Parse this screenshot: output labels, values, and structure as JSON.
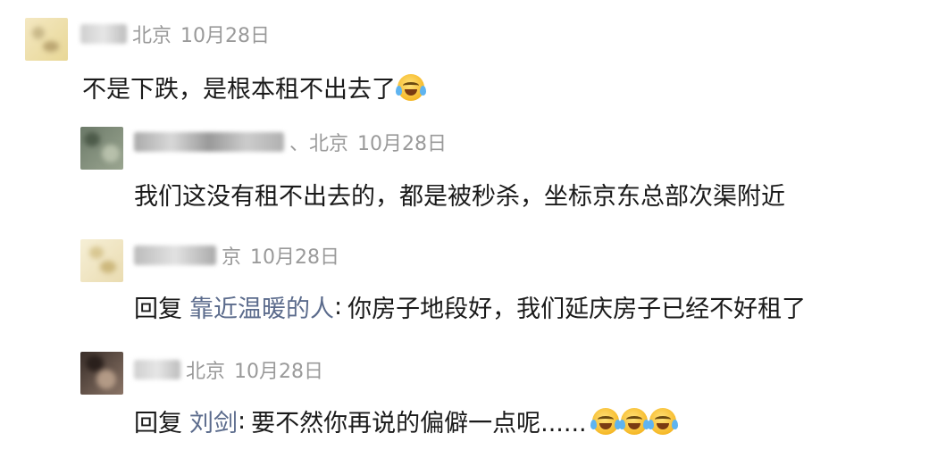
{
  "comments": [
    {
      "location": "北京",
      "date": "10月28日",
      "text": "不是下跌，是根本租不出去了"
    },
    {
      "location": "、北京",
      "date": "10月28日",
      "text": "我们这没有租不出去的，都是被秒杀，坐标京东总部次渠附近"
    },
    {
      "location": "京",
      "date": "10月28日",
      "reply_prefix": "回复",
      "reply_target": "靠近温暖的人",
      "colon": ":",
      "text": "你房子地段好，我们延庆房子已经不好租了"
    },
    {
      "location": "北京",
      "date": "10月28日",
      "reply_prefix": "回复",
      "reply_target": "刘剑",
      "colon": ":",
      "text": "要不然你再说的偏僻一点呢......"
    }
  ],
  "emoji_name": "laugh-cry-emoji"
}
